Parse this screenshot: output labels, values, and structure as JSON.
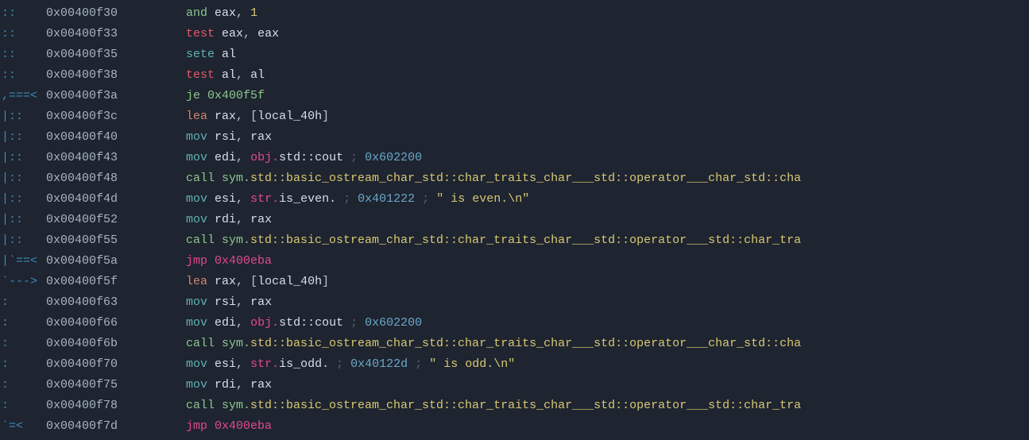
{
  "lines": [
    {
      "flow": " ::",
      "addr": "0x00400f30",
      "parts": [
        {
          "cls": "c-green",
          "t": "and"
        },
        {
          "cls": "",
          "t": " "
        },
        {
          "cls": "c-white",
          "t": "eax"
        },
        {
          "cls": "",
          "t": ", "
        },
        {
          "cls": "c-yellow",
          "t": "1"
        }
      ]
    },
    {
      "flow": " ::",
      "addr": "0x00400f33",
      "parts": [
        {
          "cls": "c-red",
          "t": "test"
        },
        {
          "cls": "",
          "t": " "
        },
        {
          "cls": "c-white",
          "t": "eax"
        },
        {
          "cls": "",
          "t": ", "
        },
        {
          "cls": "c-white",
          "t": "eax"
        }
      ]
    },
    {
      "flow": " ::",
      "addr": "0x00400f35",
      "parts": [
        {
          "cls": "c-teal",
          "t": "sete"
        },
        {
          "cls": "",
          "t": " "
        },
        {
          "cls": "c-white",
          "t": "al"
        }
      ]
    },
    {
      "flow": " ::",
      "addr": "0x00400f38",
      "parts": [
        {
          "cls": "c-red",
          "t": "test"
        },
        {
          "cls": "",
          "t": " "
        },
        {
          "cls": "c-white",
          "t": "al"
        },
        {
          "cls": "",
          "t": ", "
        },
        {
          "cls": "c-white",
          "t": "al"
        }
      ]
    },
    {
      "flow": ",===<",
      "addr": "0x00400f3a",
      "parts": [
        {
          "cls": "c-green",
          "t": "je 0x400f5f"
        }
      ]
    },
    {
      "flow": "|::",
      "addr": "0x00400f3c",
      "parts": [
        {
          "cls": "c-orange",
          "t": "lea"
        },
        {
          "cls": "",
          "t": " "
        },
        {
          "cls": "c-white",
          "t": "rax"
        },
        {
          "cls": "",
          "t": ", ["
        },
        {
          "cls": "c-white",
          "t": "local_40h"
        },
        {
          "cls": "",
          "t": "]"
        }
      ]
    },
    {
      "flow": "|::",
      "addr": "0x00400f40",
      "parts": [
        {
          "cls": "c-teal",
          "t": "mov"
        },
        {
          "cls": "",
          "t": " "
        },
        {
          "cls": "c-white",
          "t": "rsi"
        },
        {
          "cls": "",
          "t": ", "
        },
        {
          "cls": "c-white",
          "t": "rax"
        }
      ]
    },
    {
      "flow": "|::",
      "addr": "0x00400f43",
      "parts": [
        {
          "cls": "c-teal",
          "t": "mov"
        },
        {
          "cls": "",
          "t": " "
        },
        {
          "cls": "c-white",
          "t": "edi"
        },
        {
          "cls": "",
          "t": ", "
        },
        {
          "cls": "c-pink",
          "t": "obj."
        },
        {
          "cls": "c-white",
          "t": "std::cout"
        },
        {
          "cls": "",
          "t": " "
        },
        {
          "cls": "c-comment",
          "t": ";"
        },
        {
          "cls": "",
          "t": " "
        },
        {
          "cls": "c-cyan",
          "t": "0x602200"
        }
      ]
    },
    {
      "flow": "|::",
      "addr": "0x00400f48",
      "parts": [
        {
          "cls": "c-green",
          "t": "call sym."
        },
        {
          "cls": "c-yellow",
          "t": "std::basic_ostream_char_std::char_traits_char___std::operator___char_std::cha"
        }
      ]
    },
    {
      "flow": "|::",
      "addr": "0x00400f4d",
      "parts": [
        {
          "cls": "c-teal",
          "t": "mov"
        },
        {
          "cls": "",
          "t": " "
        },
        {
          "cls": "c-white",
          "t": "esi"
        },
        {
          "cls": "",
          "t": ", "
        },
        {
          "cls": "c-pink",
          "t": "str."
        },
        {
          "cls": "c-white",
          "t": "is_even."
        },
        {
          "cls": "",
          "t": " "
        },
        {
          "cls": "c-comment",
          "t": ";"
        },
        {
          "cls": "",
          "t": " "
        },
        {
          "cls": "c-cyan",
          "t": "0x401222"
        },
        {
          "cls": "",
          "t": " "
        },
        {
          "cls": "c-comment",
          "t": ";"
        },
        {
          "cls": "",
          "t": " "
        },
        {
          "cls": "c-yellow",
          "t": "\" is even.\\n\""
        }
      ]
    },
    {
      "flow": "|::",
      "addr": "0x00400f52",
      "parts": [
        {
          "cls": "c-teal",
          "t": "mov"
        },
        {
          "cls": "",
          "t": " "
        },
        {
          "cls": "c-white",
          "t": "rdi"
        },
        {
          "cls": "",
          "t": ", "
        },
        {
          "cls": "c-white",
          "t": "rax"
        }
      ]
    },
    {
      "flow": "|::",
      "addr": "0x00400f55",
      "parts": [
        {
          "cls": "c-green",
          "t": "call sym."
        },
        {
          "cls": "c-yellow",
          "t": "std::basic_ostream_char_std::char_traits_char___std::operator___std::char_tra"
        }
      ]
    },
    {
      "flow": "|`==<",
      "addr": "0x00400f5a",
      "parts": [
        {
          "cls": "c-pink",
          "t": "jmp 0x400eba"
        }
      ]
    },
    {
      "flow": "`--->",
      "addr": "0x00400f5f",
      "parts": [
        {
          "cls": "c-orange",
          "t": "lea"
        },
        {
          "cls": "",
          "t": " "
        },
        {
          "cls": "c-white",
          "t": "rax"
        },
        {
          "cls": "",
          "t": ", ["
        },
        {
          "cls": "c-white",
          "t": "local_40h"
        },
        {
          "cls": "",
          "t": "]"
        }
      ]
    },
    {
      "flow": "  :",
      "addr": "0x00400f63",
      "parts": [
        {
          "cls": "c-teal",
          "t": "mov"
        },
        {
          "cls": "",
          "t": " "
        },
        {
          "cls": "c-white",
          "t": "rsi"
        },
        {
          "cls": "",
          "t": ", "
        },
        {
          "cls": "c-white",
          "t": "rax"
        }
      ]
    },
    {
      "flow": "  :",
      "addr": "0x00400f66",
      "parts": [
        {
          "cls": "c-teal",
          "t": "mov"
        },
        {
          "cls": "",
          "t": " "
        },
        {
          "cls": "c-white",
          "t": "edi"
        },
        {
          "cls": "",
          "t": ", "
        },
        {
          "cls": "c-pink",
          "t": "obj."
        },
        {
          "cls": "c-white",
          "t": "std::cout"
        },
        {
          "cls": "",
          "t": " "
        },
        {
          "cls": "c-comment",
          "t": ";"
        },
        {
          "cls": "",
          "t": " "
        },
        {
          "cls": "c-cyan",
          "t": "0x602200"
        }
      ]
    },
    {
      "flow": "  :",
      "addr": "0x00400f6b",
      "parts": [
        {
          "cls": "c-green",
          "t": "call sym."
        },
        {
          "cls": "c-yellow",
          "t": "std::basic_ostream_char_std::char_traits_char___std::operator___char_std::cha"
        }
      ]
    },
    {
      "flow": "  :",
      "addr": "0x00400f70",
      "parts": [
        {
          "cls": "c-teal",
          "t": "mov"
        },
        {
          "cls": "",
          "t": " "
        },
        {
          "cls": "c-white",
          "t": "esi"
        },
        {
          "cls": "",
          "t": ", "
        },
        {
          "cls": "c-pink",
          "t": "str."
        },
        {
          "cls": "c-white",
          "t": "is_odd."
        },
        {
          "cls": "",
          "t": " "
        },
        {
          "cls": "c-comment",
          "t": ";"
        },
        {
          "cls": "",
          "t": " "
        },
        {
          "cls": "c-cyan",
          "t": "0x40122d"
        },
        {
          "cls": "",
          "t": " "
        },
        {
          "cls": "c-comment",
          "t": ";"
        },
        {
          "cls": "",
          "t": " "
        },
        {
          "cls": "c-yellow",
          "t": "\" is odd.\\n\""
        }
      ]
    },
    {
      "flow": "  :",
      "addr": "0x00400f75",
      "parts": [
        {
          "cls": "c-teal",
          "t": "mov"
        },
        {
          "cls": "",
          "t": " "
        },
        {
          "cls": "c-white",
          "t": "rdi"
        },
        {
          "cls": "",
          "t": ", "
        },
        {
          "cls": "c-white",
          "t": "rax"
        }
      ]
    },
    {
      "flow": "  :",
      "addr": "0x00400f78",
      "parts": [
        {
          "cls": "c-green",
          "t": "call sym."
        },
        {
          "cls": "c-yellow",
          "t": "std::basic_ostream_char_std::char_traits_char___std::operator___std::char_tra"
        }
      ]
    },
    {
      "flow": " `=<",
      "addr": "0x00400f7d",
      "parts": [
        {
          "cls": "c-pink",
          "t": "jmp 0x400eba"
        }
      ]
    }
  ]
}
